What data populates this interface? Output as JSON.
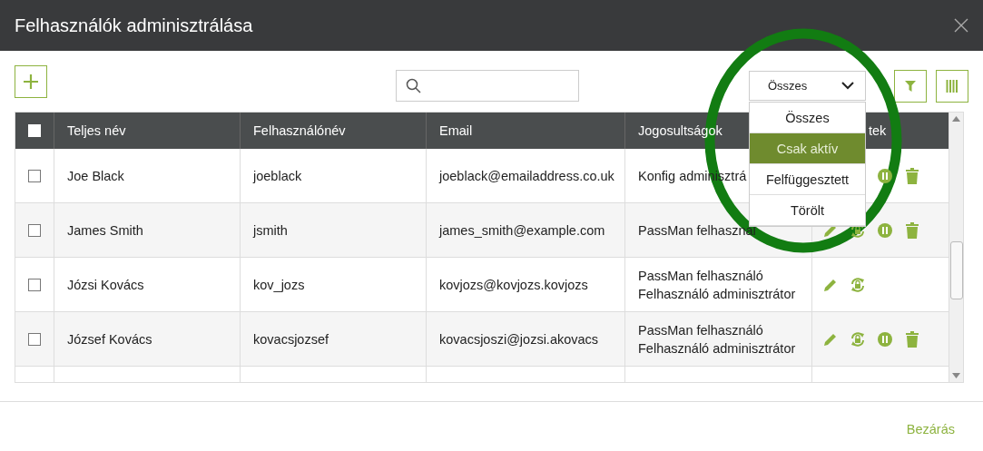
{
  "window": {
    "title": "Felhasználók adminisztrálása"
  },
  "status_filter": {
    "value": "Összes",
    "expanded": true,
    "options": [
      {
        "label": "Összes",
        "highlighted": false
      },
      {
        "label": "Csak aktív",
        "highlighted": true
      },
      {
        "label": "Felfüggesztett",
        "highlighted": false
      },
      {
        "label": "Törölt",
        "highlighted": false
      }
    ]
  },
  "table": {
    "select_all_checked": false,
    "columns": [
      "Teljes név",
      "Felhasználónév",
      "Email",
      "Jogosultságok",
      "tek"
    ],
    "rows": [
      {
        "checked": false,
        "name": "Joe Black",
        "username": "joeblack",
        "email": "joeblack@emailaddress.co.uk",
        "rights": "Konfig adminisztrá",
        "actions": [
          {
            "kind": "pause"
          },
          {
            "kind": "delete"
          }
        ]
      },
      {
        "checked": false,
        "name": "James Smith",
        "username": "jsmith",
        "email": "james_smith@example.com",
        "rights": "PassMan felhasznál",
        "actions": [
          {
            "kind": "edit"
          },
          {
            "kind": "reset"
          },
          {
            "kind": "pause"
          },
          {
            "kind": "delete"
          }
        ]
      },
      {
        "checked": false,
        "name": "Józsi Kovács",
        "username": "kov_jozs",
        "email": "kovjozs@kovjozs.kovjozs",
        "rights": "PassMan felhasználó\nFelhasználó adminisztrátor",
        "actions": [
          {
            "kind": "edit"
          },
          {
            "kind": "reset"
          }
        ]
      },
      {
        "checked": false,
        "name": "József Kovács",
        "username": "kovacsjozsef",
        "email": "kovacsjoszi@jozsi.akovacs",
        "rights": "PassMan felhasználó\nFelhasználó adminisztrátor",
        "actions": [
          {
            "kind": "edit"
          },
          {
            "kind": "reset"
          },
          {
            "kind": "pause"
          },
          {
            "kind": "delete"
          }
        ]
      }
    ]
  },
  "footer": {
    "close": "Bezárás"
  }
}
